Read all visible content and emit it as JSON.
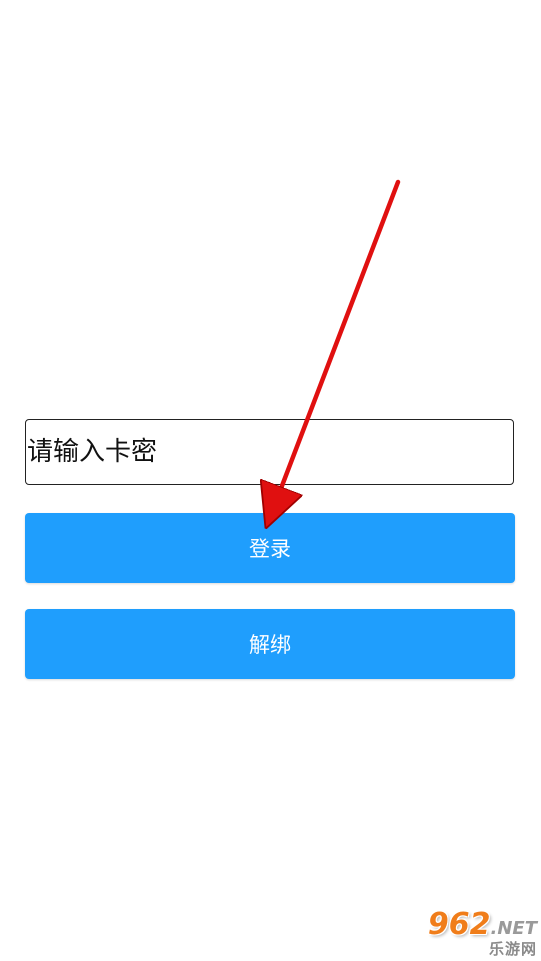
{
  "form": {
    "card_input_placeholder": "请输入卡密",
    "card_input_value": ""
  },
  "buttons": {
    "login_label": "登录",
    "unbind_label": "解绑"
  },
  "annotation": {
    "arrow_color": "#e01010",
    "arrow_target": "login-button"
  },
  "watermark": {
    "number": "962",
    "suffix": ".NET",
    "subtitle": "乐游网"
  },
  "colors": {
    "primary_button": "#1f9efd",
    "button_text": "#ffffff",
    "background": "#ffffff"
  }
}
